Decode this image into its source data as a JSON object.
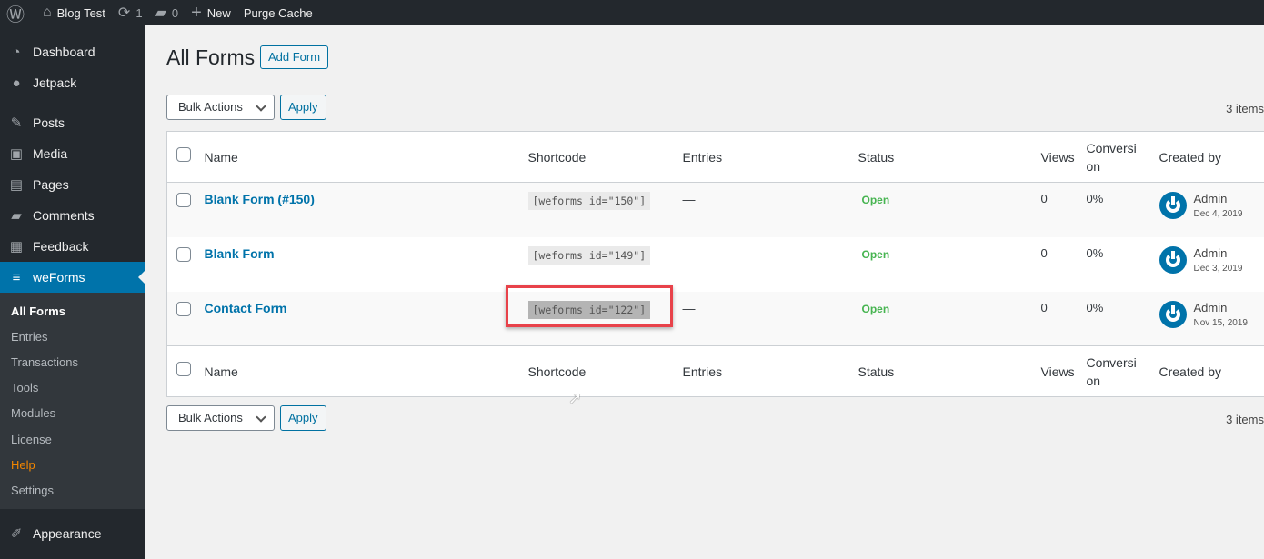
{
  "adminbar": {
    "site": "Blog Test",
    "updates": "1",
    "comments": "0",
    "new": "New",
    "purge": "Purge Cache"
  },
  "sidebar": {
    "items": [
      {
        "label": "Dashboard",
        "icon": "dashboard-icon"
      },
      {
        "label": "Jetpack",
        "icon": "jetpack-icon"
      },
      {
        "label": "Posts",
        "icon": "pin-icon"
      },
      {
        "label": "Media",
        "icon": "media-icon"
      },
      {
        "label": "Pages",
        "icon": "pages-icon"
      },
      {
        "label": "Comments",
        "icon": "comment-icon"
      },
      {
        "label": "Feedback",
        "icon": "feedback-icon"
      },
      {
        "label": "weForms",
        "icon": "weforms-icon"
      }
    ],
    "submenu": [
      "All Forms",
      "Entries",
      "Transactions",
      "Tools",
      "Modules",
      "License",
      "Help",
      "Settings"
    ],
    "appearance": "Appearance"
  },
  "page": {
    "title": "All Forms",
    "add_button": "Add Form",
    "bulk": "Bulk Actions",
    "apply": "Apply",
    "items_count": "3 items"
  },
  "table": {
    "columns": [
      "Name",
      "Shortcode",
      "Entries",
      "Status",
      "Views",
      "Conversion",
      "Created by"
    ],
    "rows": [
      {
        "name": "Blank Form (#150)",
        "shortcode": "[weforms id=\"150\"]",
        "entries": "—",
        "status": "Open",
        "views": "0",
        "conversion": "0%",
        "author": "Admin",
        "date": "Dec 4, 2019"
      },
      {
        "name": "Blank Form",
        "shortcode": "[weforms id=\"149\"]",
        "entries": "—",
        "status": "Open",
        "views": "0",
        "conversion": "0%",
        "author": "Admin",
        "date": "Dec 3, 2019"
      },
      {
        "name": "Contact Form",
        "shortcode": "[weforms id=\"122\"]",
        "entries": "—",
        "status": "Open",
        "views": "0",
        "conversion": "0%",
        "author": "Admin",
        "date": "Nov 15, 2019"
      }
    ]
  },
  "colors": {
    "accent": "#0073aa",
    "status_open": "#46b450",
    "highlight": "#e8424a"
  }
}
